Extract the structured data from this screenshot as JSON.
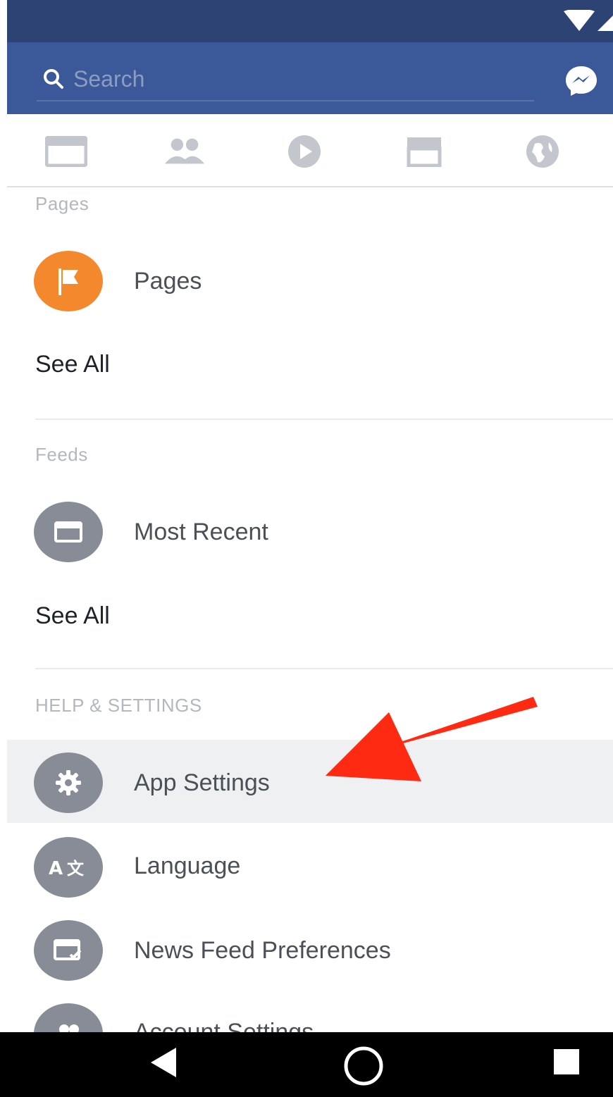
{
  "header": {
    "search_placeholder": "Search"
  },
  "tabs": [
    {
      "icon": "news-feed-icon"
    },
    {
      "icon": "friends-icon"
    },
    {
      "icon": "video-icon"
    },
    {
      "icon": "marketplace-icon"
    },
    {
      "icon": "notifications-globe-icon"
    }
  ],
  "pages_section": {
    "title": "Pages",
    "item_label": "Pages",
    "item_icon": "flag-icon",
    "see_all": "See All"
  },
  "feeds_section": {
    "title": "Feeds",
    "item_label": "Most Recent",
    "item_icon": "feed-icon",
    "see_all": "See All"
  },
  "help_section": {
    "title": "HELP & SETTINGS",
    "items": [
      {
        "label": "App Settings",
        "icon": "gear-icon",
        "highlighted": true
      },
      {
        "label": "Language",
        "icon": "language-icon"
      },
      {
        "label": "News Feed Preferences",
        "icon": "news-feed-preferences-icon"
      },
      {
        "label": "Account Settings",
        "icon": "account-icon"
      }
    ]
  },
  "colors": {
    "header": "#3b5998",
    "status_bar": "#2d4373",
    "pages_icon": "#f4882c",
    "item_icon": "#878c96",
    "annotation_arrow": "#ff2a12"
  }
}
